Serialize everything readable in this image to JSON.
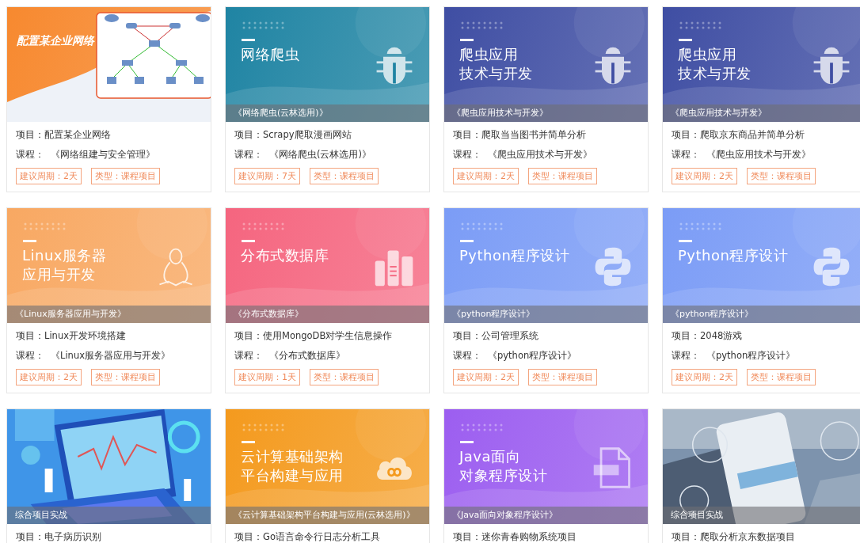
{
  "cards": [
    {
      "cover": {
        "kind": "diagram",
        "color": "#f7892f",
        "title_lines": [
          "配置某企业网络"
        ]
      },
      "project": "项目：配置某企业网络",
      "course_label": "课程：",
      "course": "《网络组建与安全管理》",
      "tags": [
        "建议周期：2天",
        "类型：课程项目"
      ]
    },
    {
      "cover": {
        "kind": "banner",
        "color": "#1f84a3",
        "title_lines": [
          "网络爬虫"
        ],
        "icon": {
          "kind": "bug"
        },
        "caption": "《网络爬虫(云林选用)》"
      },
      "project": "项目：Scrapy爬取漫画网站",
      "course_label": "课程：",
      "course": "《网络爬虫(云林选用)》",
      "tags": [
        "建议周期：7天",
        "类型：课程项目"
      ]
    },
    {
      "cover": {
        "kind": "banner",
        "color": "#3f4ea3",
        "title_lines": [
          "爬虫应用",
          "技术与开发"
        ],
        "icon": {
          "kind": "bug"
        },
        "caption": "《爬虫应用技术与开发》"
      },
      "project": "项目：爬取当当图书并简单分析",
      "course_label": "课程：",
      "course": "《爬虫应用技术与开发》",
      "tags": [
        "建议周期：2天",
        "类型：课程项目"
      ]
    },
    {
      "cover": {
        "kind": "banner",
        "color": "#3f4ea3",
        "title_lines": [
          "爬虫应用",
          "技术与开发"
        ],
        "icon": {
          "kind": "bug"
        },
        "caption": "《爬虫应用技术与开发》"
      },
      "project": "项目：爬取京东商品并简单分析",
      "course_label": "课程：",
      "course": "《爬虫应用技术与开发》",
      "tags": [
        "建议周期：2天",
        "类型：课程项目"
      ]
    },
    {
      "cover": {
        "kind": "banner",
        "color": "#f8a862",
        "title_lines": [
          "Linux服务器",
          "应用与开发"
        ],
        "icon": {
          "kind": "penguin"
        },
        "caption": "《Linux服务器应用与开发》"
      },
      "project": "项目：Linux开发环境搭建",
      "course_label": "课程：",
      "course": "《Linux服务器应用与开发》",
      "tags": [
        "建议周期：2天",
        "类型：课程项目"
      ]
    },
    {
      "cover": {
        "kind": "banner",
        "color": "#f5657f",
        "title_lines": [
          "分布式数据库"
        ],
        "icon": {
          "kind": "database"
        },
        "caption": "《分布式数据库》"
      },
      "project": "项目：使用MongoDB对学生信息操作",
      "course_label": "课程：",
      "course": "《分布式数据库》",
      "tags": [
        "建议周期：1天",
        "类型：课程项目"
      ]
    },
    {
      "cover": {
        "kind": "banner",
        "color": "#7b9cf6",
        "title_lines": [
          "Python程序设计"
        ],
        "icon": {
          "kind": "python"
        },
        "caption": "《python程序设计》"
      },
      "project": "项目：公司管理系统",
      "course_label": "课程：",
      "course": "《python程序设计》",
      "tags": [
        "建议周期：2天",
        "类型：课程项目"
      ]
    },
    {
      "cover": {
        "kind": "banner",
        "color": "#7b9cf6",
        "title_lines": [
          "Python程序设计"
        ],
        "icon": {
          "kind": "python"
        },
        "caption": "《python程序设计》"
      },
      "project": "项目：2048游戏",
      "course_label": "课程：",
      "course": "《python程序设计》",
      "tags": [
        "建议周期：2天",
        "类型：课程项目"
      ]
    },
    {
      "cover": {
        "kind": "picture",
        "color": "#3f95e8",
        "caption": "综合项目实战"
      },
      "project": "项目：电子病历识别"
    },
    {
      "cover": {
        "kind": "banner",
        "color": "#f49a1e",
        "title_lines": [
          "云计算基础架构",
          "平台构建与应用"
        ],
        "icon": {
          "kind": "cloud"
        },
        "caption": "《云计算基础架构平台构建与应用(云林选用)》"
      },
      "project": "项目：Go语言命令行日志分析工具"
    },
    {
      "cover": {
        "kind": "banner",
        "color": "#9c5ef0",
        "title_lines": [
          "Java面向",
          "对象程序设计"
        ],
        "icon": {
          "kind": "java-file"
        },
        "caption": "《Java面向对象程序设计》"
      },
      "project": "项目：迷你青春购物系统项目"
    },
    {
      "cover": {
        "color": "#7d93ad",
        "caption": "综合项目实战"
      },
      "project": "项目：爬取分析京东数据项目"
    }
  ]
}
